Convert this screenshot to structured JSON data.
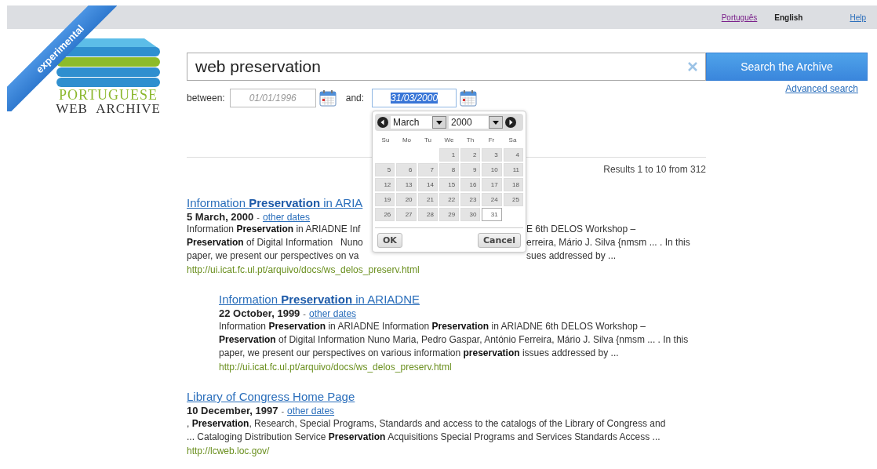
{
  "top_bar": {
    "languages": [
      {
        "label": "Português",
        "selected": false
      },
      {
        "label": "English",
        "selected": true
      }
    ],
    "help": "Help"
  },
  "ribbon": "experimental",
  "logo": {
    "line1": "PORTUGUESE",
    "line2": "WEB ARCHIVE"
  },
  "search": {
    "value": "web preservation",
    "button": "Search the Archive",
    "advanced": "Advanced search"
  },
  "date_range": {
    "from_label": "between:",
    "from": "01/01/1996",
    "to_label": "and:",
    "to": "31/03/2000",
    "to_highlighted": true
  },
  "calendar": {
    "month": "March",
    "year": "2000",
    "weekdays": [
      "Su",
      "Mo",
      "Tu",
      "We",
      "Th",
      "Fr",
      "Sa"
    ],
    "weeks": [
      [
        {
          "kind": "blank"
        },
        {
          "kind": "blank"
        },
        {
          "kind": "blank"
        },
        {
          "label": "1",
          "selected": false
        },
        {
          "label": "2",
          "selected": false
        },
        {
          "label": "3",
          "selected": false
        },
        {
          "label": "4",
          "selected": false
        }
      ],
      [
        {
          "label": "5",
          "selected": false
        },
        {
          "label": "6",
          "selected": false
        },
        {
          "label": "7",
          "selected": false
        },
        {
          "label": "8",
          "selected": false
        },
        {
          "label": "9",
          "selected": false
        },
        {
          "label": "10",
          "selected": false
        },
        {
          "label": "11",
          "selected": false
        }
      ],
      [
        {
          "label": "12",
          "selected": false
        },
        {
          "label": "13",
          "selected": false
        },
        {
          "label": "14",
          "selected": false
        },
        {
          "label": "15",
          "selected": false
        },
        {
          "label": "16",
          "selected": false
        },
        {
          "label": "17",
          "selected": false
        },
        {
          "label": "18",
          "selected": false
        }
      ],
      [
        {
          "label": "19",
          "selected": false
        },
        {
          "label": "20",
          "selected": false
        },
        {
          "label": "21",
          "selected": false
        },
        {
          "label": "22",
          "selected": false
        },
        {
          "label": "23",
          "selected": false
        },
        {
          "label": "24",
          "selected": false
        },
        {
          "label": "25",
          "selected": false
        }
      ],
      [
        {
          "label": "26",
          "selected": false
        },
        {
          "label": "27",
          "selected": false
        },
        {
          "label": "28",
          "selected": false
        },
        {
          "label": "29",
          "selected": false
        },
        {
          "label": "30",
          "selected": false
        },
        {
          "label": "31",
          "selected": true
        },
        {
          "kind": "blank"
        }
      ]
    ],
    "ok": "OK",
    "cancel": "Cancel"
  },
  "results_count": "Results 1 to 10 from 312",
  "results": [
    {
      "kind": "covered",
      "title": "Information **Preservation** in ARIA",
      "date": "5 March, 2000",
      "separator": "-",
      "other_dates": "other dates",
      "snippet_lines": [
        {
          "left": "Information **Preservation** in ARIADNE Inf",
          "right": "E 6th DELOS Workshop –"
        },
        {
          "left": "**Preservation** of Digital Information   Nuno",
          "right": "erreira, Mário J. Silva {nmsm ... . In this"
        },
        {
          "left": "paper, we present our perspectives on va",
          "right": "sues addressed by ..."
        }
      ],
      "url": "http://ui.icat.fc.ul.pt/arquivo/docs/ws_delos_preserv.html",
      "children": [
        {
          "kind": "plain",
          "title": "Information **Preservation** in ARIADNE",
          "date": "22 October, 1999",
          "separator": "-",
          "other_dates": "other dates",
          "snippet": "Information **Preservation** in ARIADNE Information **Preservation** in ARIADNE 6th DELOS Workshop – **Preservation** of Digital Information   Nuno Maria, Pedro Gaspar, António Ferreira, Mário J. Silva {nmsm ... . In this paper, we present our perspectives on various information **preservation** issues addressed by ...",
          "url": "http://ui.icat.fc.ul.pt/arquivo/docs/ws_delos_preserv.html"
        }
      ]
    },
    {
      "kind": "plain",
      "title": "Library of Congress Home Page",
      "date": "10 December, 1997",
      "separator": "-",
      "other_dates": "other dates",
      "snippet": ", **Preservation**, Research, Special Programs, Standards and access to the catalogs of the Library of Congress and ... Cataloging Distribution Service **Preservation** Acquisitions Special Programs and Services Standards Access ...",
      "url": "http://lcweb.loc.gov/"
    }
  ]
}
